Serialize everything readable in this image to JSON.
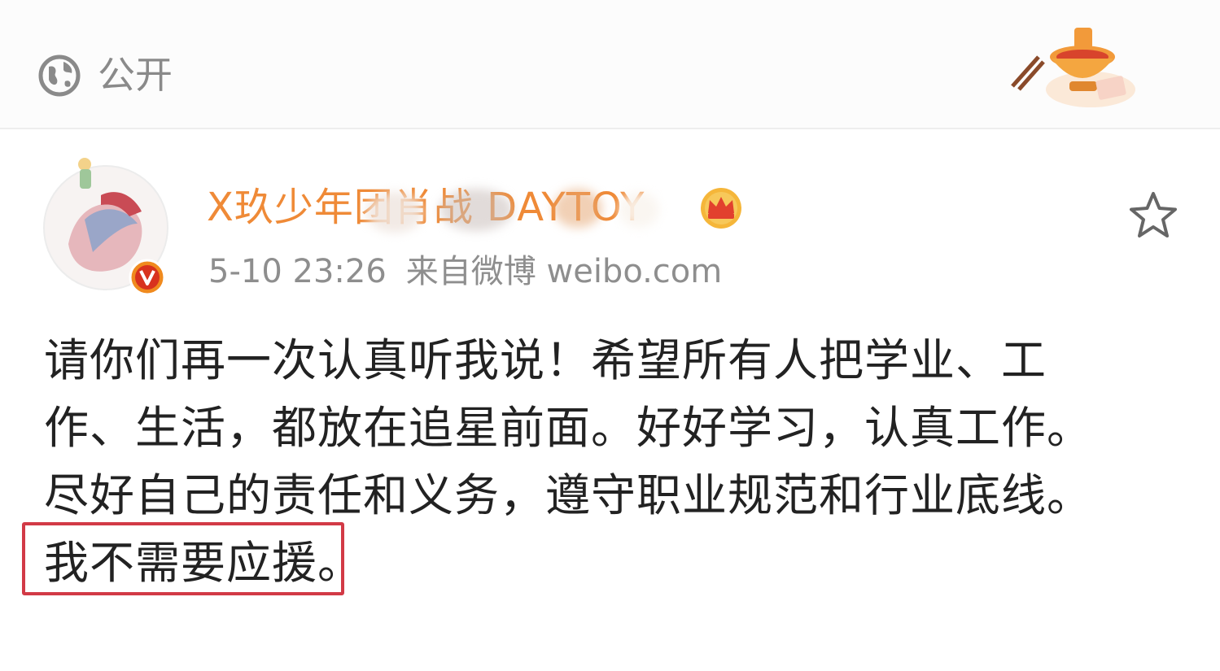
{
  "header": {
    "visibility_label": "公开",
    "globe_icon": "globe-icon",
    "sticker_icon": "hotpot-sticker-icon"
  },
  "post": {
    "username": "X玖少年团肖战 DAYTOY",
    "badge_icon": "crown-icon",
    "verified_icon": "verified-v-icon",
    "timestamp": "5-10 23:26",
    "source": "来自微博 weibo.com",
    "favorite_icon": "star-icon",
    "text_lines": [
      "请你们再一次认真听我说！希望所有人把学业、工",
      "作、生活，都放在追星前面。好好学习，认真工作。",
      "尽好自己的责任和义务，遵守职业规范和行业底线。",
      "我不需要应援。"
    ]
  },
  "colors": {
    "username": "#ef8a37",
    "meta": "#8e8e8e",
    "body_text": "#222222",
    "highlight_border": "#d23a46",
    "header_text": "#8a8a8a"
  }
}
